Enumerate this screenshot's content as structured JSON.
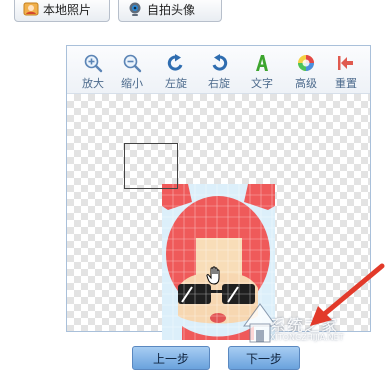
{
  "top_tabs": {
    "local_photo": "本地照片",
    "selfie_avatar": "自拍头像"
  },
  "toolbar": {
    "zoom_in": "放大",
    "zoom_out": "缩小",
    "rotate_left": "左旋",
    "rotate_right": "右旋",
    "text": "文字",
    "advanced": "高级",
    "reset": "重置"
  },
  "footer": {
    "prev_label": "上一步",
    "next_label": "下一步"
  },
  "watermark": {
    "site_name": "系统之家",
    "site_url": "XITONGZHIJIA.NET"
  },
  "colors": {
    "arrow": "#e23a2a",
    "button": "#7fb2e6",
    "frame": "#a9c0da"
  }
}
